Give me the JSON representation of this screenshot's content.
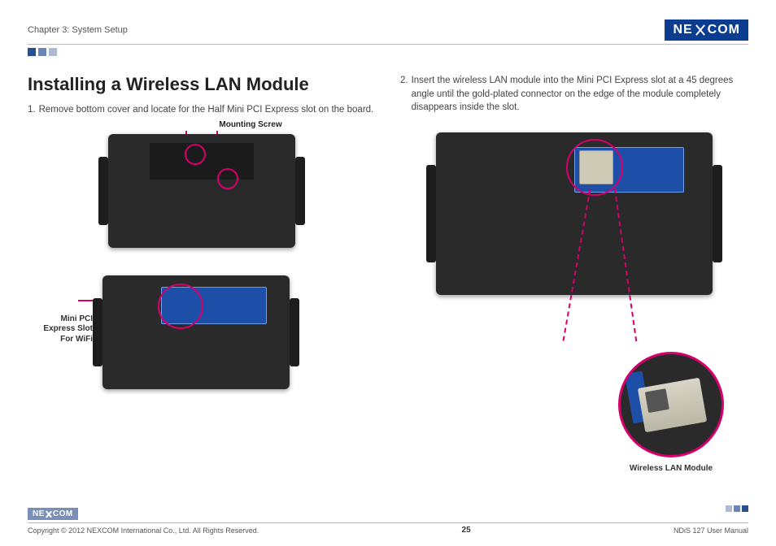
{
  "header": {
    "chapter": "Chapter 3: System Setup",
    "brand_left": "NE",
    "brand_right": "COM"
  },
  "title": "Installing a Wireless LAN Module",
  "steps": {
    "s1_num": "1.",
    "s1_text": "Remove bottom cover and locate for the Half Mini PCI Express slot on the board.",
    "s2_num": "2.",
    "s2_text": "Insert the wireless LAN module into the Mini PCI Express slot at a 45 degrees angle until the gold-plated connector on the edge of the module completely disappears inside the slot."
  },
  "labels": {
    "mounting_screw": "Mounting Screw",
    "mini_pci_slot_l1": "Mini PCI",
    "mini_pci_slot_l2": "Express Slot",
    "mini_pci_slot_l3": "For WiFi",
    "wlan_module": "Wireless LAN Module"
  },
  "footer": {
    "copyright": "Copyright © 2012 NEXCOM International Co., Ltd. All Rights Reserved.",
    "page": "25",
    "doc": "NDiS 127 User Manual",
    "brand_left": "NE",
    "brand_right": "COM"
  }
}
